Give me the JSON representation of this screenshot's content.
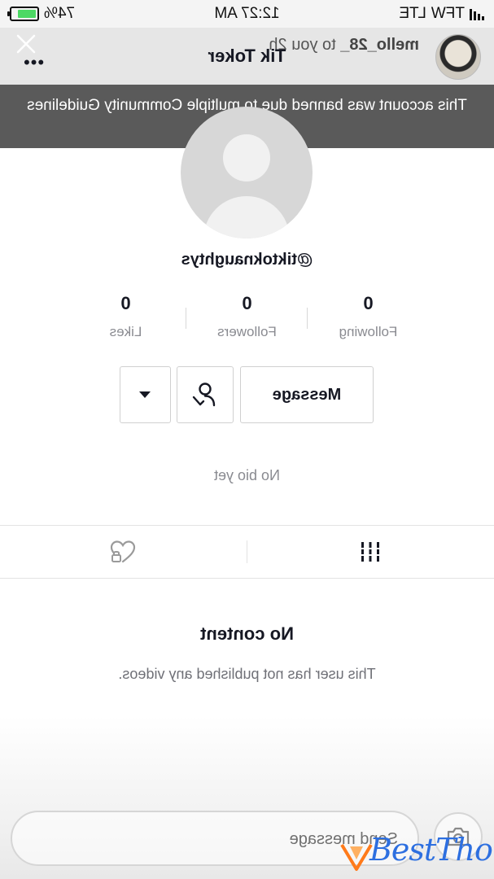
{
  "status_bar": {
    "carrier": "TFW",
    "network": "LTE",
    "time": "12:27 AM",
    "battery": "74%"
  },
  "story": {
    "username": "mello_28_",
    "sent_to": "to you",
    "age": "2h"
  },
  "header": {
    "title": "Tik Toker",
    "more": "•••"
  },
  "banner": {
    "text": "This account was banned due to multiple Community Guidelines violations."
  },
  "profile": {
    "handle": "@tiktoknaughtys",
    "stats": [
      {
        "value": "0",
        "label": "Following"
      },
      {
        "value": "0",
        "label": "Followers"
      },
      {
        "value": "0",
        "label": "Likes"
      }
    ],
    "message_button": "Message",
    "bio": "No bio yet"
  },
  "empty_state": {
    "title": "No content",
    "subtitle": "This user has not published any videos."
  },
  "reply": {
    "placeholder": "Send message"
  },
  "watermark": {
    "text": "BestThot"
  },
  "colors": {
    "banner_bg": "#5a5a5a",
    "text_primary": "#161823",
    "text_secondary": "#8a8b91",
    "watermark": "#2d6fe0"
  }
}
